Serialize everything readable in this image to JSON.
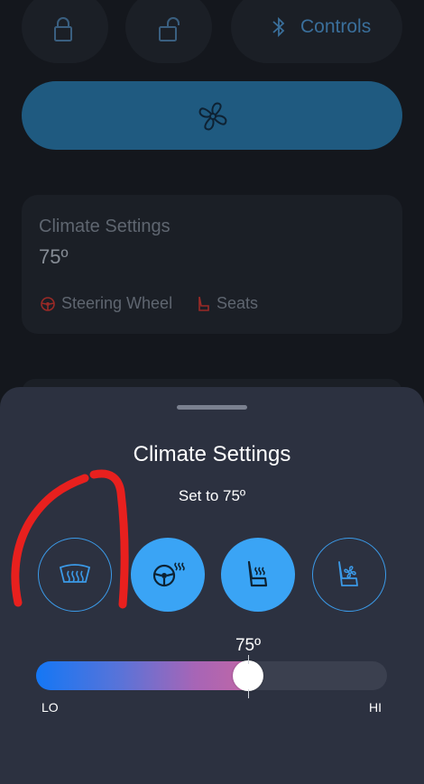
{
  "top_bar": {
    "controls_label": "Controls"
  },
  "card": {
    "title": "Climate Settings",
    "temperature": "75º",
    "features": [
      {
        "label": "Steering Wheel",
        "icon": "steering-wheel-icon"
      },
      {
        "label": "Seats",
        "icon": "seat-icon"
      }
    ]
  },
  "sheet": {
    "title": "Climate Settings",
    "subtitle": "Set to 75º",
    "buttons": [
      {
        "name": "rear-defrost-button",
        "icon": "rear-defrost-icon",
        "active": false
      },
      {
        "name": "heated-steering-wheel-button",
        "icon": "heated-steering-wheel-icon",
        "active": true
      },
      {
        "name": "heated-seat-button",
        "icon": "heated-seat-icon",
        "active": true
      },
      {
        "name": "ventilated-seat-button",
        "icon": "ventilated-seat-icon",
        "active": false
      }
    ],
    "slider": {
      "value_label": "75º",
      "min_label": "LO",
      "max_label": "HI",
      "fraction": 0.605
    }
  },
  "colors": {
    "accent": "#3aa4f5",
    "sheet_bg": "#2c3140",
    "annotation_marker": "#e8201e"
  }
}
